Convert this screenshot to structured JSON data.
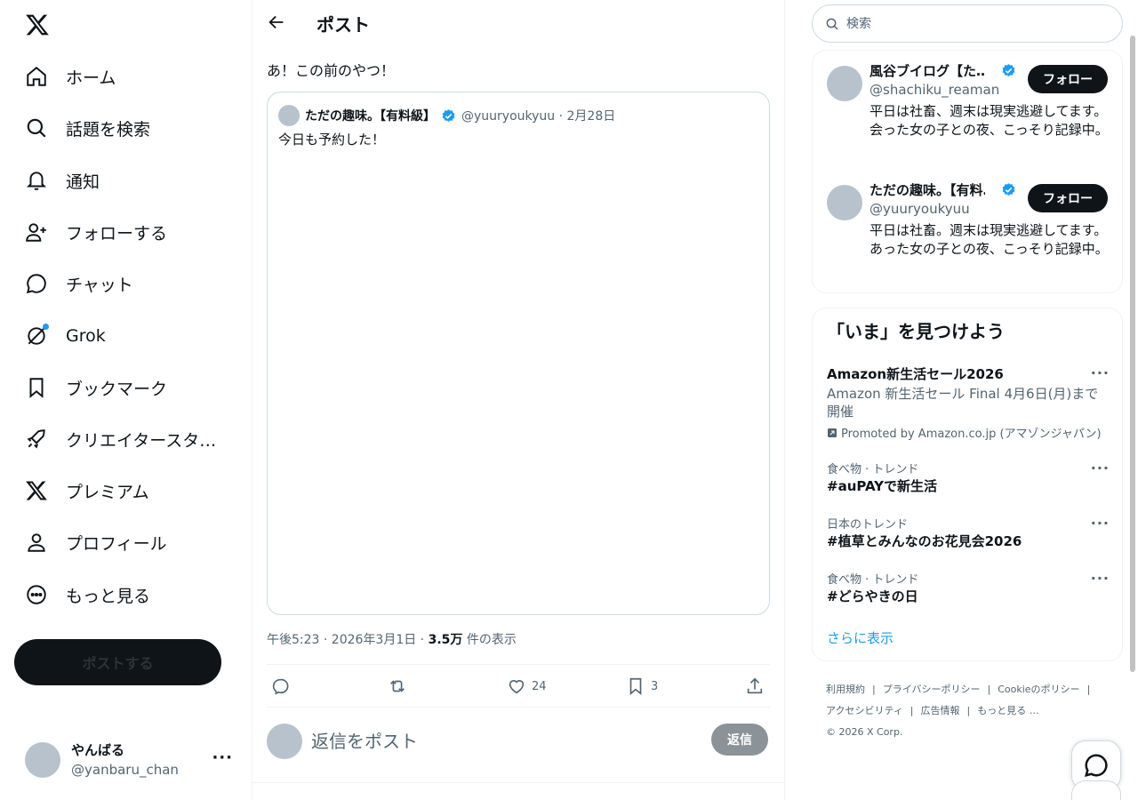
{
  "nav": {
    "items": [
      {
        "label": "ホーム",
        "icon": "home-icon"
      },
      {
        "label": "話題を検索",
        "icon": "search-icon"
      },
      {
        "label": "通知",
        "icon": "bell-icon"
      },
      {
        "label": "フォローする",
        "icon": "follow-icon"
      },
      {
        "label": "チャット",
        "icon": "chat-icon"
      },
      {
        "label": "Grok",
        "icon": "grok-icon"
      },
      {
        "label": "ブックマーク",
        "icon": "bookmark-icon"
      },
      {
        "label": "クリエイタースタ…",
        "icon": "rocket-icon"
      },
      {
        "label": "プレミアム",
        "icon": "x-icon"
      },
      {
        "label": "プロフィール",
        "icon": "profile-icon"
      },
      {
        "label": "もっと見る",
        "icon": "more-icon"
      }
    ],
    "post_button": "ポストする"
  },
  "account": {
    "name": "やんばる",
    "handle": "@yanbaru_chan",
    "more": "···"
  },
  "header": {
    "title": "ポスト"
  },
  "post": {
    "text": "あ！この前のやつ！",
    "quote": {
      "name": "ただの趣味。【有料級】",
      "handle_date": "@yuuryoukyuu · 2月28日",
      "text": "今日も予約した！"
    },
    "meta_time": "午後5:23 · 2026年3月1日 · ",
    "views": "3.5万",
    "views_label": " 件の表示",
    "likes": "24",
    "bookmarks": "3"
  },
  "reply": {
    "placeholder": "返信をポスト",
    "button": "返信"
  },
  "search": {
    "placeholder": "検索"
  },
  "who_to_follow": [
    {
      "name": "風谷ブイログ【た…",
      "handle": "@shachiku_reaman",
      "bio": "平日は社畜、週末は現実逃避してます。会った女の子との夜、こっそり記録中。",
      "button": "フォロー"
    },
    {
      "name": "ただの趣味。【有料…",
      "handle": "@yuuryoukyuu",
      "bio": "平日は社畜。週末は現実逃避してます。あった女の子との夜、こっそり記録中。",
      "button": "フォロー"
    }
  ],
  "trends": {
    "title": "「いま」を見つけよう",
    "items": [
      {
        "category": "",
        "name": "Amazon新生活セール2026",
        "desc": "Amazon 新生活セール Final 4月6日(月)まで開催",
        "promo": "Promoted by Amazon.co.jp (アマゾンジャパン)"
      },
      {
        "category": "食べ物 · トレンド",
        "name": "#auPAYで新生活"
      },
      {
        "category": "日本のトレンド",
        "name": "#植草とみんなのお花見会2026"
      },
      {
        "category": "食べ物 · トレンド",
        "name": "#どらやきの日"
      }
    ],
    "show_more": "さらに表示",
    "more": "···"
  },
  "footer": {
    "links": [
      "利用規約",
      "|",
      "プライバシーポリシー",
      "|",
      "Cookieのポリシー",
      "|",
      "アクセシビリティ",
      "|",
      "広告情報",
      "|",
      "もっと見る …"
    ],
    "copyright": "© 2026 X Corp."
  },
  "colors": {
    "accent": "#1d9bf0",
    "text": "#0f1419",
    "muted": "#536471",
    "verified": "#1d9bf0"
  }
}
